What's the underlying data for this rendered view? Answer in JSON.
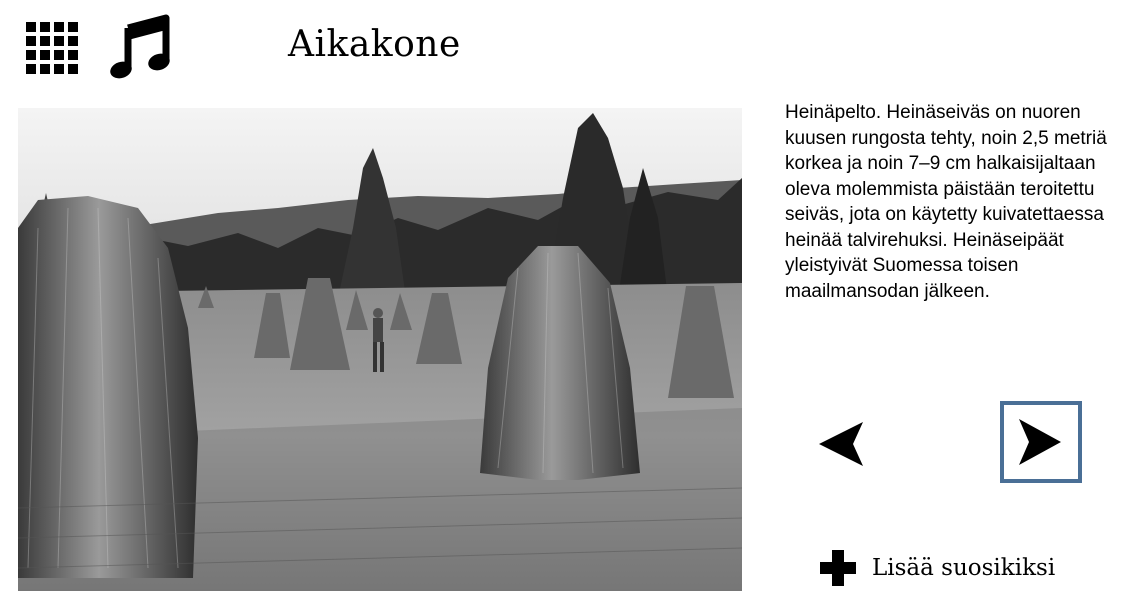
{
  "app": {
    "title": "Aikakone",
    "menu_icon": "grid-menu-icon",
    "music_icon": "music-note-icon"
  },
  "photo": {
    "subject": "hay-stooks-field-photo"
  },
  "caption": {
    "text": "Heinäpelto. Heinäseiväs on nuoren kuusen rungosta tehty, noin 2,5 metriä korkea ja noin 7–9 cm halkaisijaltaan oleva molemmista päistään teroitettu seiväs, jota on käytetty kuivatettaessa heinää talvirehuksi. Heinäseipäät yleistyivät Suomessa toisen maailmansodan jälkeen."
  },
  "navigation": {
    "prev_icon": "arrow-left-icon",
    "next_icon": "arrow-right-icon",
    "next_border_color": "#4a6f96"
  },
  "favorite": {
    "label": "Lisää suosikiksi",
    "icon": "plus-icon"
  }
}
